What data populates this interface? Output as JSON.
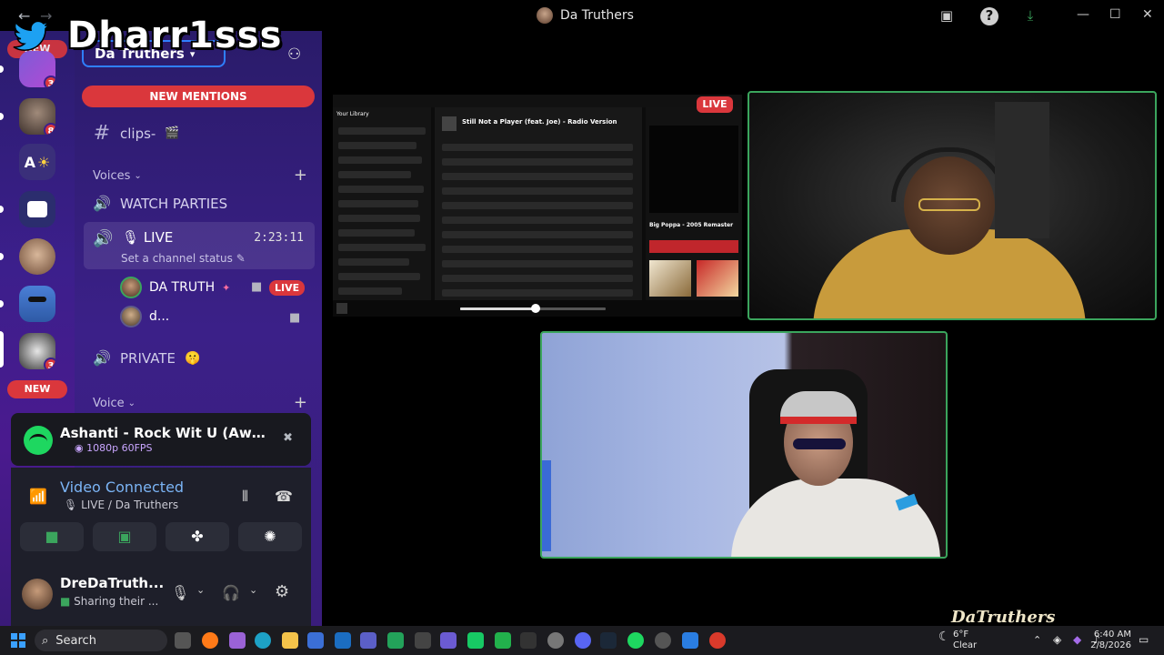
{
  "overlay": {
    "streamer_name": "Dharr1sss"
  },
  "titlebar": {
    "back": "←",
    "forward": "→",
    "title": "Da Truthers",
    "minimize": "—",
    "maximize": "☐",
    "close": "✕"
  },
  "rail": {
    "badges": [
      "3",
      "8",
      "3"
    ],
    "new_label_top": "NEW",
    "new_label_bottom": "NEW",
    "letter_server": "A"
  },
  "sidebar": {
    "server_name": "Da Truthers",
    "new_mentions": "NEW MENTIONS",
    "channels": {
      "clips": "clips-",
      "voices_category": "Voices",
      "watch_parties": "WATCH PARTIES",
      "live": "LIVE",
      "live_timer": "2:23:11",
      "live_status": "Set a channel status",
      "private": "PRIVATE",
      "voice_category": "Voice"
    },
    "voice_users": [
      {
        "name": "DA TRUTH",
        "live": "LIVE"
      },
      {
        "name": "d..."
      }
    ]
  },
  "activity": {
    "title": "Ashanti - Rock Wit U (Awww ...",
    "quality": "1080p 60FPS"
  },
  "voice": {
    "title": "Video Connected",
    "subtitle": "LIVE / Da Truthers"
  },
  "user": {
    "name": "DreDaTruth...",
    "status": "Sharing their ..."
  },
  "stream": {
    "live_badge": "LIVE",
    "spotify": {
      "header": "Still Not a Player (feat. Joe) - Radio Version",
      "now_playing_title": "Big Poppa - 2005 Remaster",
      "library_label": "Your Library"
    }
  },
  "taskbar": {
    "search": "Search",
    "weather_temp": "6°F",
    "weather_desc": "Clear",
    "time": "6:40 AM",
    "date": "2/8/2026"
  },
  "watermark": "DaTruthers",
  "colors": {
    "accent_red": "#da373c",
    "connected_green": "#3ba55d",
    "spotify_green": "#1ed760",
    "link_blue": "#7bb4f5"
  }
}
